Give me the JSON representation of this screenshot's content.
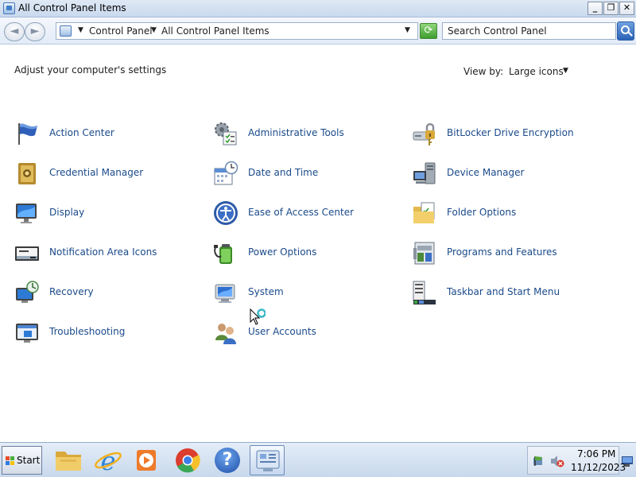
{
  "window": {
    "title": "All Control Panel Items",
    "minimize_glyph": "_",
    "maximize_glyph": "❐",
    "close_glyph": "✕"
  },
  "address": {
    "back_glyph": "◄",
    "forward_glyph": "►",
    "crumbs": [
      "Control Panel",
      "All Control Panel Items"
    ],
    "separator_glyph": "▼",
    "refresh_glyph": "⟳",
    "search_placeholder": "Search Control Panel"
  },
  "content": {
    "heading": "Adjust your computer's settings",
    "view_by_label": "View by:",
    "view_by_value": "Large icons",
    "view_by_arrow": "▼"
  },
  "items": [
    {
      "label": "Action Center",
      "icon": "flag-icon"
    },
    {
      "label": "Administrative Tools",
      "icon": "admin-tools-icon"
    },
    {
      "label": "BitLocker Drive Encryption",
      "icon": "bitlocker-icon"
    },
    {
      "label": "Credential Manager",
      "icon": "vault-icon"
    },
    {
      "label": "Date and Time",
      "icon": "clock-calendar-icon"
    },
    {
      "label": "Device Manager",
      "icon": "device-manager-icon"
    },
    {
      "label": "Display",
      "icon": "monitor-icon"
    },
    {
      "label": "Ease of Access Center",
      "icon": "ease-of-access-icon"
    },
    {
      "label": "Folder Options",
      "icon": "folder-options-icon"
    },
    {
      "label": "Notification Area Icons",
      "icon": "notification-area-icon"
    },
    {
      "label": "Power Options",
      "icon": "battery-icon"
    },
    {
      "label": "Programs and Features",
      "icon": "programs-icon"
    },
    {
      "label": "Recovery",
      "icon": "recovery-icon"
    },
    {
      "label": "System",
      "icon": "system-icon"
    },
    {
      "label": "Taskbar and Start Menu",
      "icon": "taskbar-icon"
    },
    {
      "label": "Troubleshooting",
      "icon": "troubleshooting-icon"
    },
    {
      "label": "User Accounts",
      "icon": "users-icon"
    }
  ],
  "taskbar": {
    "start_label": "Start",
    "apps": [
      "file-explorer-icon",
      "internet-explorer-icon",
      "media-player-icon",
      "chrome-icon",
      "help-icon",
      "control-panel-icon"
    ],
    "help_glyph": "?",
    "clock_time": "7:06 PM",
    "clock_date": "11/12/2023"
  },
  "colors": {
    "link": "#1a4a8a",
    "titlebar": "#dfe9f5"
  }
}
